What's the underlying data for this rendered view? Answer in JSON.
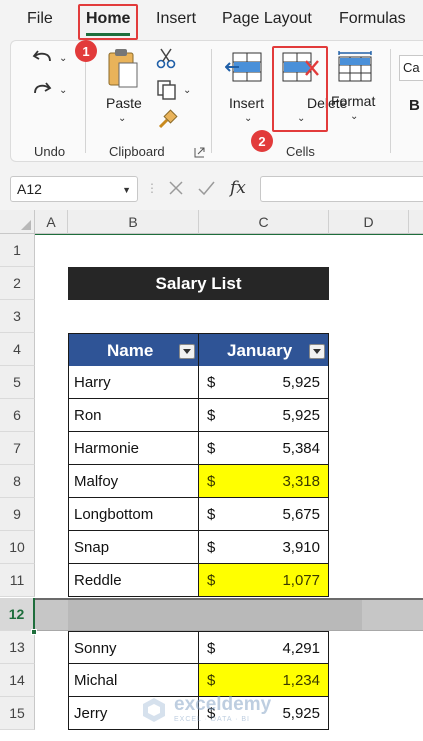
{
  "menu": {
    "tabs": [
      "File",
      "Home",
      "Insert",
      "Page Layout",
      "Formulas"
    ],
    "active_tab": "Home"
  },
  "steps": [
    "1",
    "2"
  ],
  "ribbon": {
    "undo_group": "Undo",
    "clipboard_group": "Clipboard",
    "cells_group": "Cells",
    "paste_label": "Paste",
    "insert_label": "Insert",
    "delete_label": "Delete",
    "format_label": "Format",
    "font_box_text": "Ca",
    "bold_label": "B"
  },
  "formula_bar": {
    "name_box": "A12",
    "fx_label": "fx",
    "formula": ""
  },
  "columns": [
    "A",
    "B",
    "C",
    "D"
  ],
  "rows": [
    "1",
    "2",
    "3",
    "4",
    "5",
    "6",
    "7",
    "8",
    "9",
    "10",
    "11",
    "12",
    "13",
    "14",
    "15"
  ],
  "selected_row": "12",
  "table": {
    "title": "Salary List",
    "headers": [
      "Name",
      "January"
    ],
    "currency": "$",
    "entries": [
      {
        "row": 5,
        "name": "Harry",
        "value": "5,925",
        "highlight": false
      },
      {
        "row": 6,
        "name": "Ron",
        "value": "5,925",
        "highlight": false
      },
      {
        "row": 7,
        "name": "Harmonie",
        "value": "5,384",
        "highlight": false
      },
      {
        "row": 8,
        "name": "Malfoy",
        "value": "3,318",
        "highlight": true
      },
      {
        "row": 9,
        "name": "Longbottom",
        "value": "5,675",
        "highlight": false
      },
      {
        "row": 10,
        "name": "Snap",
        "value": "3,910",
        "highlight": false
      },
      {
        "row": 11,
        "name": "Reddle",
        "value": "1,077",
        "highlight": true
      },
      {
        "row": 13,
        "name": "Sonny",
        "value": "4,291",
        "highlight": false
      },
      {
        "row": 14,
        "name": "Michal",
        "value": "1,234",
        "highlight": true
      },
      {
        "row": 15,
        "name": "Jerry",
        "value": "5,925",
        "highlight": false
      }
    ]
  },
  "watermark": {
    "brand": "exceldemy",
    "tagline": "EXCEL · DATA · BI"
  },
  "colors": {
    "accent_green": "#1e6e3c",
    "header_blue": "#2f5496",
    "highlight_yellow": "#ffff00",
    "callout_red": "#e23b3b"
  }
}
